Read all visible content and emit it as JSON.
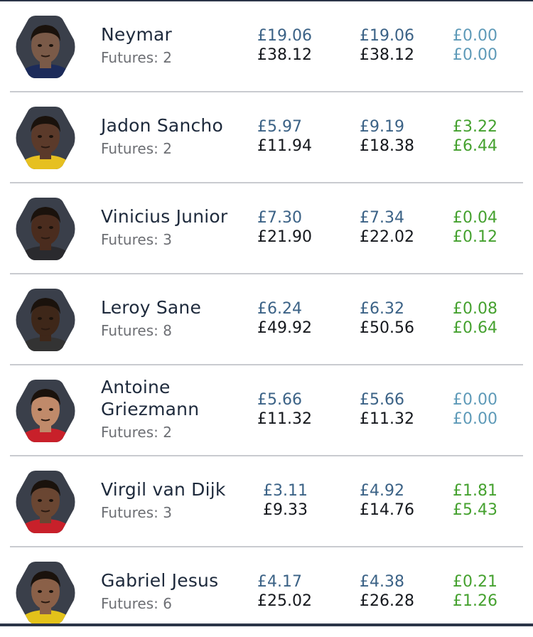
{
  "players": [
    {
      "name": "Neymar",
      "futures": "Futures: 2",
      "col1": [
        "£19.06",
        "£38.12"
      ],
      "col2": [
        "£19.06",
        "£38.12"
      ],
      "col3": [
        "£0.00",
        "£0.00"
      ],
      "change_status": "neutral",
      "avatar_color": "#7a5a48",
      "shirt_color": "#1c2b5a"
    },
    {
      "name": "Jadon Sancho",
      "futures": "Futures: 2",
      "col1": [
        "£5.97",
        "£11.94"
      ],
      "col2": [
        "£9.19",
        "£18.38"
      ],
      "col3": [
        "£3.22",
        "£6.44"
      ],
      "change_status": "positive",
      "avatar_color": "#5b3a2a",
      "shirt_color": "#e6c020"
    },
    {
      "name": "Vinicius Junior",
      "futures": "Futures: 3",
      "col1": [
        "£7.30",
        "£21.90"
      ],
      "col2": [
        "£7.34",
        "£22.02"
      ],
      "col3": [
        "£0.04",
        "£0.12"
      ],
      "change_status": "positive",
      "avatar_color": "#4a2c1e",
      "shirt_color": "#2a2a2e"
    },
    {
      "name": "Leroy Sane",
      "futures": "Futures: 8",
      "col1": [
        "£6.24",
        "£49.92"
      ],
      "col2": [
        "£6.32",
        "£50.56"
      ],
      "col3": [
        "£0.08",
        "£0.64"
      ],
      "change_status": "positive",
      "avatar_color": "#3e2719",
      "shirt_color": "#333333"
    },
    {
      "name": "Antoine Griezmann",
      "futures": "Futures: 2",
      "col1": [
        "£5.66",
        "£11.32"
      ],
      "col2": [
        "£5.66",
        "£11.32"
      ],
      "col3": [
        "£0.00",
        "£0.00"
      ],
      "change_status": "neutral",
      "avatar_color": "#c08a6a",
      "shirt_color": "#c8202a"
    },
    {
      "name": "Virgil van Dijk",
      "futures": "Futures: 3",
      "col1": [
        "£3.11",
        "£9.33"
      ],
      "col2": [
        "£4.92",
        "£14.76"
      ],
      "col3": [
        "£1.81",
        "£5.43"
      ],
      "change_status": "positive",
      "avatar_color": "#6a4632",
      "shirt_color": "#c8202a"
    },
    {
      "name": "Gabriel Jesus",
      "futures": "Futures: 6",
      "col1": [
        "£4.17",
        "£25.02"
      ],
      "col2": [
        "£4.38",
        "£26.28"
      ],
      "col3": [
        "£0.21",
        "£1.26"
      ],
      "change_status": "positive",
      "avatar_color": "#8a6048",
      "shirt_color": "#e3c21a"
    }
  ]
}
